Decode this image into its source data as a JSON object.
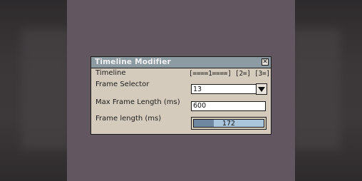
{
  "window": {
    "title": "Timeline Modifier",
    "close_glyph": "✕"
  },
  "fields": {
    "timeline_label": "Timeline",
    "timeline_value": "[====1====] [2=] [3=]",
    "frame_selector_label": "Frame Selector",
    "frame_selector_value": "13",
    "max_frame_label": "Max Frame Length (ms)",
    "max_frame_value": "600",
    "frame_length_label": "Frame length (ms)",
    "frame_length_value": "172",
    "frame_length_fraction": 0.287
  },
  "colors": {
    "canvas_bg": "#625661",
    "window_bg": "#d4cbbc",
    "titlebar_bg": "#8c9aa2",
    "slider_track": "#a9c6dd",
    "slider_fill": "#6f87a0"
  },
  "icons": {
    "close": "close-icon",
    "dropdown": "triangle-down-icon"
  }
}
